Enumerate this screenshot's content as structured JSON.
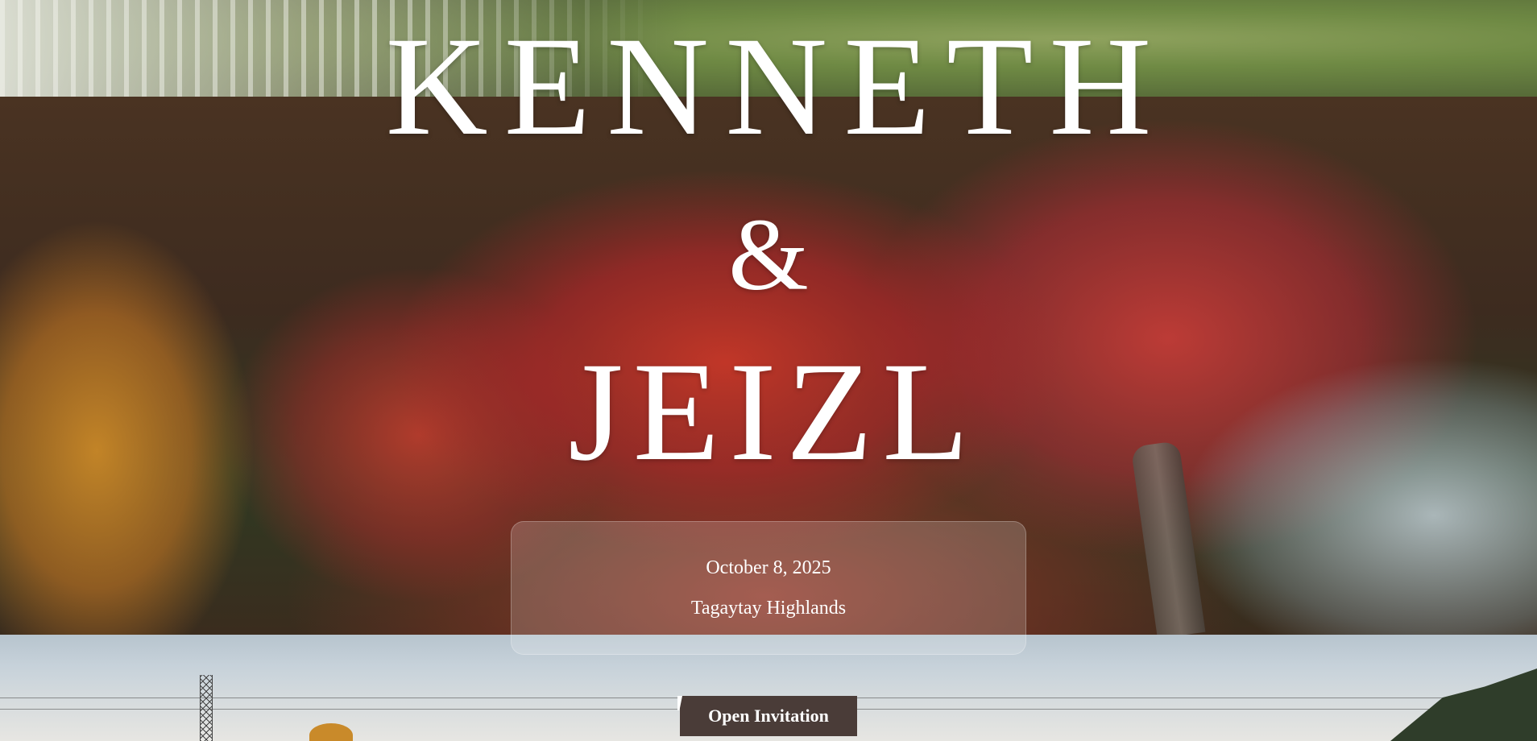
{
  "hero": {
    "name_1": "KENNETH",
    "ampersand": "&",
    "name_2": "JEIZL"
  },
  "details": {
    "date": "October 8, 2025",
    "venue": "Tagaytay Highlands"
  },
  "cta": {
    "label": "Open Invitation"
  },
  "colors": {
    "button_bg": "#4a3c38",
    "text": "#ffffff"
  }
}
